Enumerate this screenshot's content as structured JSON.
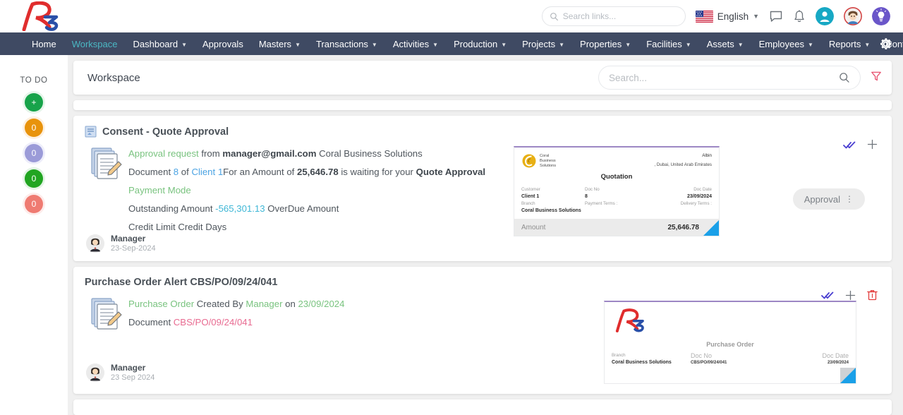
{
  "header": {
    "logo_text": "R3",
    "search": {
      "placeholder": "Search links...",
      "value": ""
    },
    "language": {
      "label": "English",
      "flag": "us-flag-icon"
    },
    "icons": [
      "chat-icon",
      "bell-icon",
      "user-icon",
      "profile-avatar",
      "idea-bulb-icon"
    ]
  },
  "nav": {
    "items": [
      {
        "label": "Home",
        "caret": false,
        "active": false
      },
      {
        "label": "Workspace",
        "caret": false,
        "active": true
      },
      {
        "label": "Dashboard",
        "caret": true,
        "active": false
      },
      {
        "label": "Approvals",
        "caret": false,
        "active": false
      },
      {
        "label": "Masters",
        "caret": true,
        "active": false
      },
      {
        "label": "Transactions",
        "caret": true,
        "active": false
      },
      {
        "label": "Activities",
        "caret": true,
        "active": false
      },
      {
        "label": "Production",
        "caret": true,
        "active": false
      },
      {
        "label": "Projects",
        "caret": true,
        "active": false
      },
      {
        "label": "Properties",
        "caret": true,
        "active": false
      },
      {
        "label": "Facilities",
        "caret": true,
        "active": false
      },
      {
        "label": "Assets",
        "caret": true,
        "active": false
      },
      {
        "label": "Employees",
        "caret": true,
        "active": false
      },
      {
        "label": "Reports",
        "caret": true,
        "active": false
      },
      {
        "label": "Configurat",
        "caret": false,
        "active": false
      }
    ],
    "settings_icon": "gear-icon",
    "accent_color": "#4bb8c4",
    "background_color": "#3f4a63"
  },
  "sidebar": {
    "title": "TO DO",
    "badges": [
      {
        "value": "+",
        "color": "#17a34a",
        "name": "add-todo"
      },
      {
        "value": "0",
        "color": "#e8930c",
        "name": "todo-count-orange"
      },
      {
        "value": "0",
        "color": "#9b9bd8",
        "name": "todo-count-purple"
      },
      {
        "value": "0",
        "color": "#21a521",
        "name": "todo-count-green"
      },
      {
        "value": "0",
        "color": "#ef7b72",
        "name": "todo-count-red"
      }
    ]
  },
  "workspace": {
    "title": "Workspace",
    "search": {
      "placeholder": "Search...",
      "value": ""
    },
    "filter_icon": "filter-funnel-icon",
    "filter_color": "#e8516f"
  },
  "cards": [
    {
      "title": "Consent - Quote Approval",
      "title_icon": "document-report-icon",
      "doc_icon": "documents-edit-icon",
      "lines": [
        {
          "parts": [
            {
              "t": "Approval request",
              "s": "g"
            },
            {
              "t": " from ",
              "s": ""
            },
            {
              "t": "manager@gmail.com",
              "s": "b bold"
            },
            {
              "t": " Coral Business Solutions",
              "s": ""
            }
          ]
        },
        {
          "parts": [
            {
              "t": "Document ",
              "s": ""
            },
            {
              "t": "8",
              "s": "b"
            },
            {
              "t": " of ",
              "s": ""
            },
            {
              "t": "Client 1",
              "s": "b"
            },
            {
              "t": "For an Amount of ",
              "s": ""
            },
            {
              "t": "25,646.78",
              "s": "bold"
            },
            {
              "t": " is waiting for your ",
              "s": ""
            },
            {
              "t": "Quote Approval",
              "s": "bold"
            }
          ]
        },
        {
          "parts": [
            {
              "t": "Payment Mode",
              "s": "g"
            }
          ]
        },
        {
          "parts": [
            {
              "t": "Outstanding Amount ",
              "s": ""
            },
            {
              "t": "-565,301.13",
              "s": "cy"
            },
            {
              "t": "    OverDue Amount",
              "s": ""
            }
          ]
        },
        {
          "parts": [
            {
              "t": "Credit Limit    Credit Days",
              "s": ""
            }
          ]
        }
      ],
      "actions": [
        "double-check-icon",
        "plus-icon"
      ],
      "button": {
        "label": "Approval",
        "menu": "⋮"
      },
      "preview": {
        "type": "quotation",
        "company_logo": "coral-business-solutions-logo",
        "company_name": "Coral Business Solutions",
        "contact_name": "Albin",
        "contact_address": ", Dubai, United Arab Emirates",
        "doc_title": "Quotation",
        "fields": [
          {
            "label": "Customer",
            "value": "Client 1"
          },
          {
            "label": "Doc No",
            "value": "8"
          },
          {
            "label": "Doc Date",
            "value": "23/09/2024"
          },
          {
            "label": "Branch",
            "value": "Coral Business Solutions"
          },
          {
            "label": "Payment Terms :",
            "value": ""
          },
          {
            "label": "Delivery Terms :",
            "value": ""
          }
        ],
        "amount_label": "Amount",
        "amount_value": "25,646.78"
      },
      "footer": {
        "avatar": "manager-avatar",
        "name": "Manager",
        "date": "23-Sep-2024"
      }
    },
    {
      "title": "Purchase Order Alert CBS/PO/09/24/041",
      "title_icon": "",
      "doc_icon": "documents-edit-icon",
      "lines": [
        {
          "parts": [
            {
              "t": "Purchase Order",
              "s": "g"
            },
            {
              "t": " Created By ",
              "s": ""
            },
            {
              "t": "Manager",
              "s": "g"
            },
            {
              "t": " on ",
              "s": ""
            },
            {
              "t": "23/09/2024",
              "s": "g"
            }
          ]
        },
        {
          "parts": [
            {
              "t": "Document ",
              "s": ""
            },
            {
              "t": "CBS/PO/09/24/041",
              "s": "pk"
            }
          ]
        }
      ],
      "actions": [
        "double-check-icon",
        "plus-icon",
        "delete-trash-icon"
      ],
      "button": null,
      "preview": {
        "type": "purchase-order",
        "company_logo": "r3-logo",
        "doc_title": "Purchase Order",
        "fields": [
          {
            "label": "Branch",
            "value": "Coral Business Solutions"
          },
          {
            "label": "Doc No",
            "value": "CBS/PO/09/24/041"
          },
          {
            "label": "Doc Date",
            "value": "23/09/2024"
          }
        ]
      },
      "footer": {
        "avatar": "manager-avatar",
        "name": "Manager",
        "date": "23 Sep 2024"
      }
    }
  ]
}
